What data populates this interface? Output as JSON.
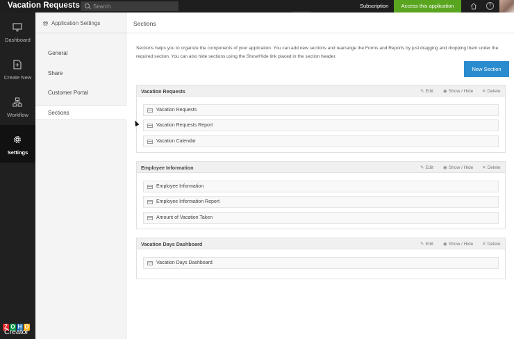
{
  "topbar": {
    "app_title": "Vacation Requests",
    "search_placeholder": "Search",
    "subscription_label": "Subscription",
    "access_button": "Access this application",
    "help_label": "?"
  },
  "leftnav": {
    "items": [
      {
        "label": "Dashboard",
        "icon": "monitor-icon"
      },
      {
        "label": "Create New",
        "icon": "new-document-icon"
      },
      {
        "label": "Workflow",
        "icon": "workflow-icon"
      },
      {
        "label": "Settings",
        "icon": "gear-icon",
        "active": true
      }
    ],
    "logo_letters": [
      "Z",
      "O",
      "H",
      "O"
    ],
    "logo_letter_colors": [
      "#e42527",
      "#089949",
      "#226db4",
      "#f9b21d"
    ],
    "logo_word": "Creator"
  },
  "settings_sidebar": {
    "title": "Application Settings",
    "items": [
      "General",
      "Share",
      "Customer Portal",
      "Sections"
    ],
    "active": "Sections"
  },
  "main": {
    "title": "Sections",
    "description": "Sections helps you to organize the components of your application. You can add new sections and rearrange the Forms and Reports by just dragging and dropping them under the required section. You can also hide sections using the Show/Hide link placed in the section header.",
    "new_section_button": "New Section",
    "actions": {
      "edit": "Edit",
      "show_hide": "Show / Hide",
      "delete": "Delete"
    },
    "sections": [
      {
        "title": "Vacation Requests",
        "components": [
          "Vacation Requests",
          "Vacation Requests Report",
          "Vacation Calendar"
        ]
      },
      {
        "title": "Employee Information",
        "components": [
          "Employee Information",
          "Employee Information Report",
          "Amount of Vacation Taken"
        ]
      },
      {
        "title": "Vacation Days Dashboard",
        "components": [
          "Vacation Days Dashboard"
        ]
      }
    ]
  },
  "colors": {
    "topbar_bg": "#1e1e1e",
    "access_green": "#5aa51f",
    "primary_blue": "#2a8ccf",
    "nav_bg": "#202020"
  }
}
